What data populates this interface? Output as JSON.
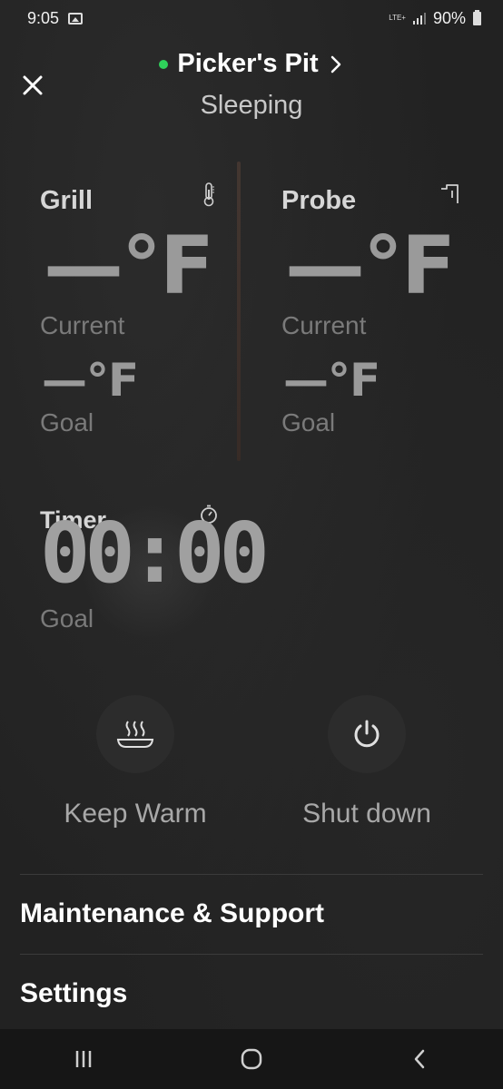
{
  "status_bar": {
    "time": "9:05",
    "network": "LTE+",
    "battery": "90%"
  },
  "header": {
    "device_name": "Picker's Pit",
    "state": "Sleeping"
  },
  "grill": {
    "title": "Grill",
    "current_value": "—°F",
    "current_label": "Current",
    "goal_value": "—°F",
    "goal_label": "Goal"
  },
  "probe": {
    "title": "Probe",
    "current_value": "—°F",
    "current_label": "Current",
    "goal_value": "—°F",
    "goal_label": "Goal"
  },
  "timer": {
    "title": "Timer",
    "value": "00:00",
    "goal_label": "Goal"
  },
  "actions": {
    "keep_warm": "Keep Warm",
    "shut_down": "Shut down"
  },
  "menu": {
    "maintenance": "Maintenance & Support",
    "settings": "Settings"
  },
  "colors": {
    "online": "#2fd15a",
    "background": "#222222"
  }
}
